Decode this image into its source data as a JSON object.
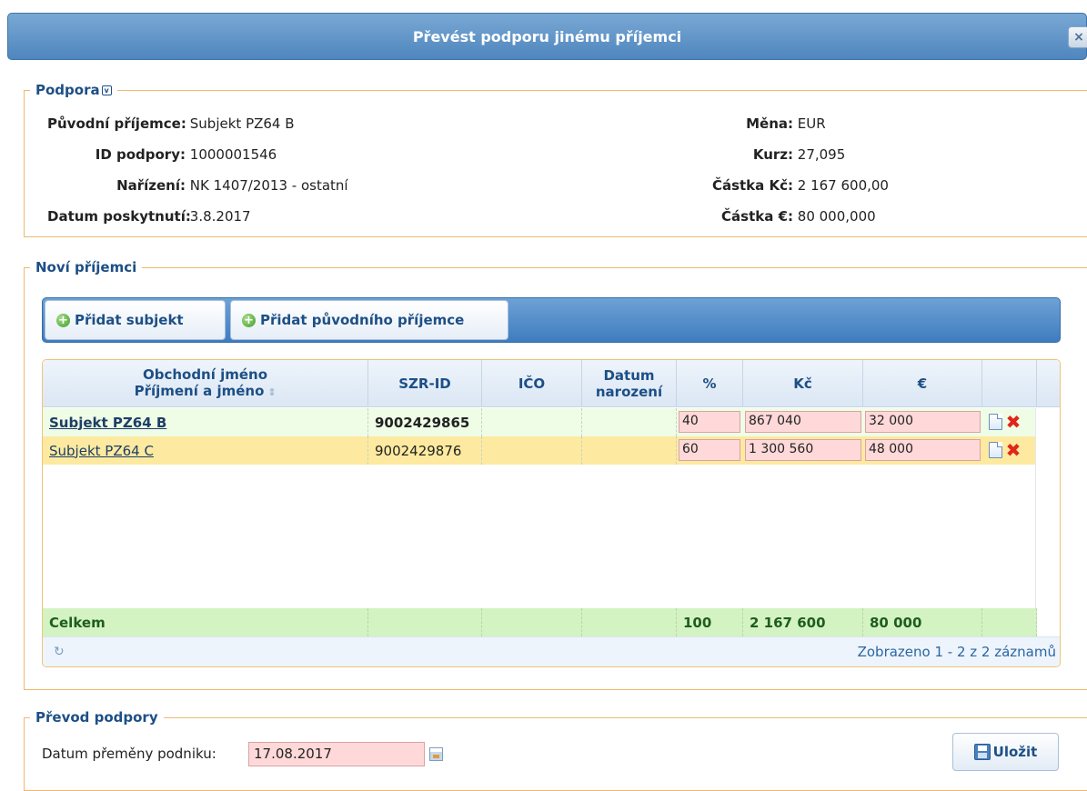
{
  "dialog": {
    "title": "Převést podporu jinému příjemci",
    "close_label": "×"
  },
  "podpora": {
    "legend": "Podpora",
    "left": [
      {
        "label": "Původní příjemce:",
        "value": "Subjekt PZ64 B"
      },
      {
        "label": "ID podpory:",
        "value": "1000001546"
      },
      {
        "label": "Nařízení:",
        "value": "NK 1407/2013 - ostatní"
      },
      {
        "label": "Datum poskytnutí:",
        "value": "3.8.2017"
      }
    ],
    "right": [
      {
        "label": "Měna:",
        "value": "EUR"
      },
      {
        "label": "Kurz:",
        "value": "27,095"
      },
      {
        "label": "Částka Kč:",
        "value": "2 167 600,00"
      },
      {
        "label": "Částka €:",
        "value": "80 000,000"
      }
    ]
  },
  "novi": {
    "legend": "Noví příjemci",
    "toolbar": {
      "add_subject": "Přidat subjekt",
      "add_original": "Přidat původního příjemce"
    },
    "columns": {
      "name_line1": "Obchodní jméno",
      "name_line2": "Příjmení a jméno",
      "szr": "SZR-ID",
      "ico": "IČO",
      "birth_line1": "Datum",
      "birth_line2": "narození",
      "pct": "%",
      "czk": "Kč",
      "eur": "€"
    },
    "rows": [
      {
        "name": "Subjekt PZ64 B",
        "szr": "9002429865",
        "ico": "",
        "birth": "",
        "pct": "40",
        "czk": "867 040",
        "eur": "32 000"
      },
      {
        "name": "Subjekt PZ64 C",
        "szr": "9002429876",
        "ico": "",
        "birth": "",
        "pct": "60",
        "czk": "1 300 560",
        "eur": "48 000"
      }
    ],
    "total": {
      "label": "Celkem",
      "pct": "100",
      "czk": "2 167 600",
      "eur": "80 000"
    },
    "pager": {
      "text": "Zobrazeno 1 - 2 z 2 záznamů"
    }
  },
  "prevod": {
    "legend": "Převod podpory",
    "date_label": "Datum přeměny podniku:",
    "date_value": "17.08.2017",
    "save_label": "Uložit"
  }
}
